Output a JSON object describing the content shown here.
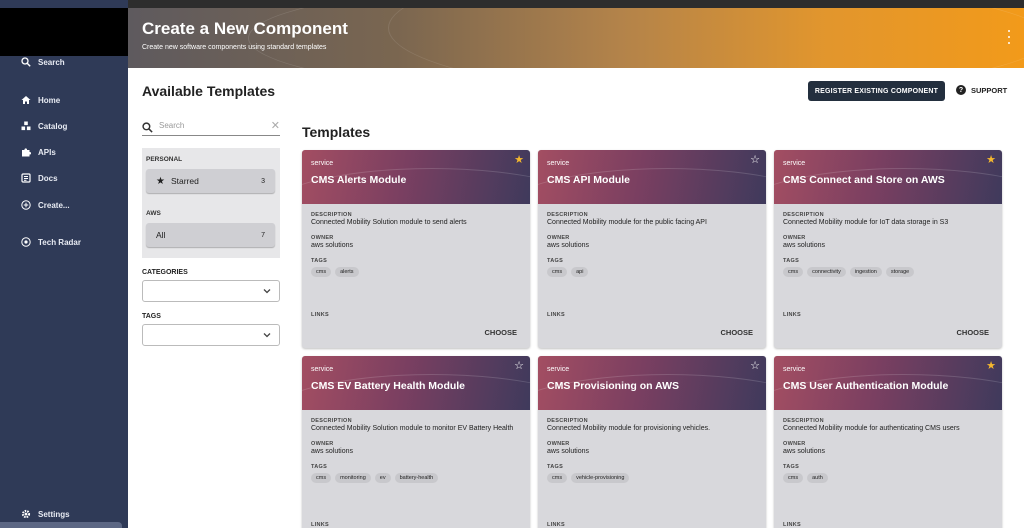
{
  "sidebar": {
    "items": [
      {
        "name": "sidebar-item-search",
        "icon": "search-icon",
        "label": "Search"
      },
      {
        "name": "sidebar-item-home",
        "icon": "home-icon",
        "label": "Home"
      },
      {
        "name": "sidebar-item-catalog",
        "icon": "catalog-icon",
        "label": "Catalog"
      },
      {
        "name": "sidebar-item-apis",
        "icon": "puzzle-icon",
        "label": "APIs"
      },
      {
        "name": "sidebar-item-docs",
        "icon": "docs-icon",
        "label": "Docs"
      },
      {
        "name": "sidebar-item-create",
        "icon": "add-circle-icon",
        "label": "Create..."
      },
      {
        "name": "sidebar-item-tech-radar",
        "icon": "radar-icon",
        "label": "Tech Radar"
      },
      {
        "name": "sidebar-item-settings",
        "icon": "gear-icon",
        "label": "Settings"
      }
    ]
  },
  "header": {
    "title": "Create a New Component",
    "subtitle": "Create new software components using standard templates"
  },
  "main": {
    "page_title": "Available Templates",
    "register_label": "REGISTER EXISTING COMPONENT",
    "support_label": "SUPPORT",
    "templates_title": "Templates"
  },
  "filters": {
    "search_placeholder": "Search",
    "personal_label": "PERSONAL",
    "starred_label": "Starred",
    "starred_count": "3",
    "aws_label": "AWS",
    "all_label": "All",
    "all_count": "7",
    "categories_label": "CATEGORIES",
    "tags_label": "TAGS"
  },
  "card_labels": {
    "description": "DESCRIPTION",
    "owner": "OWNER",
    "tags": "TAGS",
    "links": "LINKS",
    "choose": "CHOOSE"
  },
  "cards": [
    {
      "type": "service",
      "title": "CMS Alerts Module",
      "starred": true,
      "description": "Connected Mobility Solution module to send alerts",
      "owner": "aws solutions",
      "tags": [
        "cms",
        "alerts"
      ]
    },
    {
      "type": "service",
      "title": "CMS API Module",
      "starred": false,
      "description": "Connected Mobility module for the public facing API",
      "owner": "aws solutions",
      "tags": [
        "cms",
        "api"
      ]
    },
    {
      "type": "service",
      "title": "CMS Connect and Store on AWS",
      "starred": true,
      "description": "Connected Mobility module for IoT data storage in S3",
      "owner": "aws solutions",
      "tags": [
        "cms",
        "connectivity",
        "ingestion",
        "storage"
      ]
    },
    {
      "type": "service",
      "title": "CMS EV Battery Health Module",
      "starred": false,
      "description": "Connected Mobility Solution module to monitor EV Battery Health",
      "owner": "aws solutions",
      "tags": [
        "cms",
        "monitoring",
        "ev",
        "battery-health"
      ]
    },
    {
      "type": "service",
      "title": "CMS Provisioning on AWS",
      "starred": false,
      "description": "Connected Mobility module for provisioning vehicles.",
      "owner": "aws solutions",
      "tags": [
        "cms",
        "vehicle-provisioning"
      ]
    },
    {
      "type": "service",
      "title": "CMS User Authentication Module",
      "starred": true,
      "description": "Connected Mobility module for authenticating CMS users",
      "owner": "aws solutions",
      "tags": [
        "cms",
        "auth"
      ]
    }
  ],
  "colors": {
    "sidebar_bg": "#2f3a57",
    "register_btn": "#232f3e",
    "star_on": "#f5b82e"
  }
}
